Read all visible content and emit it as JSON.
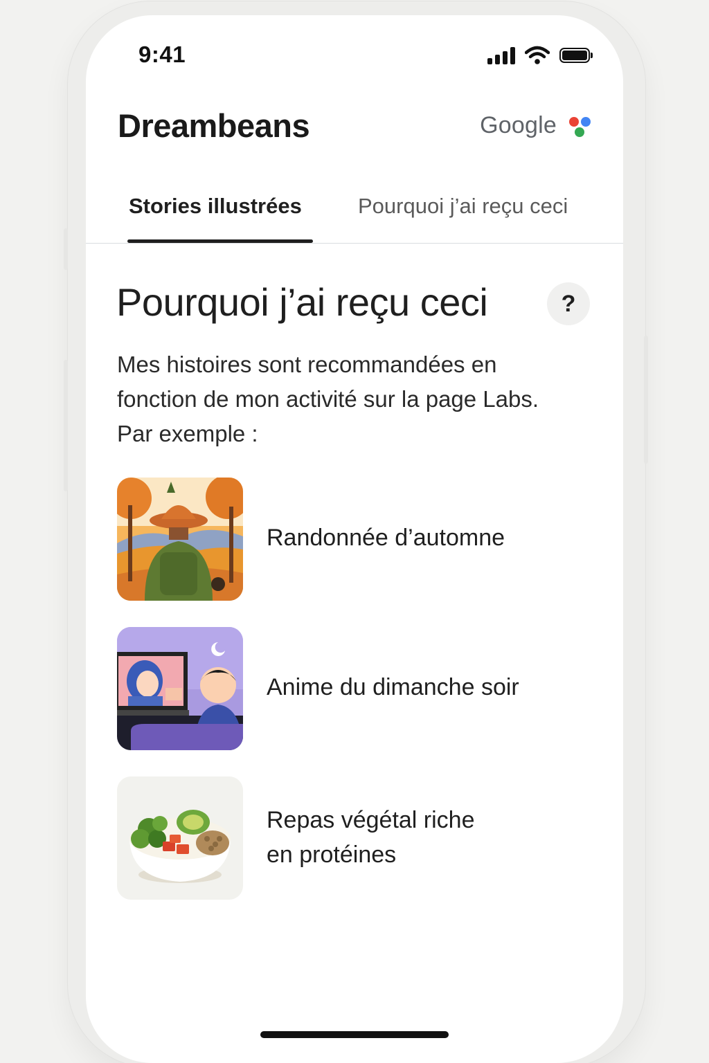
{
  "status_bar": {
    "time": "9:41",
    "icons": [
      "signal-icon",
      "wifi-icon",
      "battery-icon"
    ]
  },
  "header": {
    "app_title": "Dreambeans",
    "brand": "Google",
    "brand_dots_colors": [
      "#ea4335",
      "#4285f4",
      "#34a853"
    ]
  },
  "tabs": [
    {
      "label": "Stories illustrées",
      "active": true
    },
    {
      "label": "Pourquoi j’ai reçu ceci",
      "active": false
    }
  ],
  "section": {
    "title": "Pourquoi j’ai reçu ceci",
    "help_label": "?",
    "description_lines": [
      "Mes histoires sont recommandées en",
      "fonction de mon activité sur la page Labs.",
      "Par exemple :"
    ]
  },
  "recommendations": [
    {
      "label_lines": [
        "Randonnée d’automne"
      ],
      "thumbnail": "autumn-hike-image"
    },
    {
      "label_lines": [
        "Anime du dimanche soir"
      ],
      "thumbnail": "sunday-anime-image"
    },
    {
      "label_lines": [
        "Repas végétal riche",
        "en protéines"
      ],
      "thumbnail": "plant-protein-bowl-image"
    }
  ],
  "colors": {
    "text_primary": "#1f1f1f",
    "tab_indicator": "#1f1f1f",
    "divider": "#dadce0"
  }
}
